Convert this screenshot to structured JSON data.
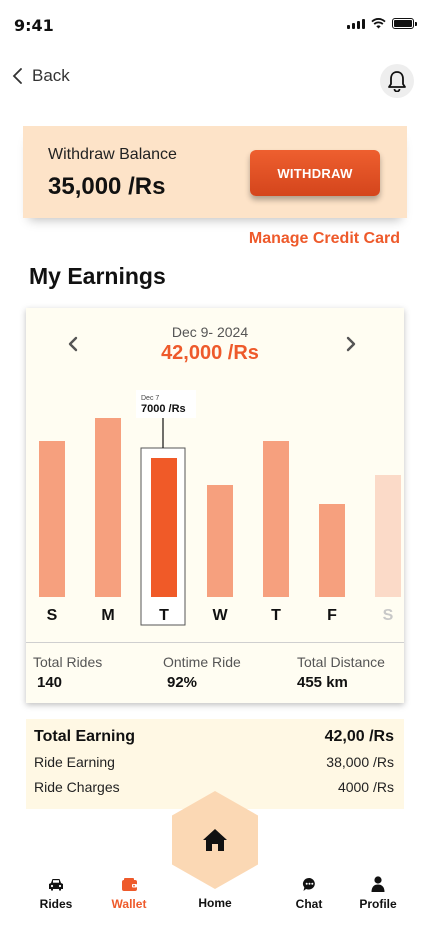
{
  "status_bar": {
    "time": "9:41"
  },
  "header": {
    "back_label": "Back"
  },
  "balance": {
    "label": "Withdraw Balance",
    "value": "35,000 /Rs",
    "withdraw_label": "WITHDRAW",
    "manage_label": "Manage Credit Card"
  },
  "earnings": {
    "title": "My Earnings",
    "date_range": "Dec 9- 2024",
    "total": "42,000 /Rs",
    "tooltip": {
      "date": "Dec 7",
      "value": "7000 /Rs"
    },
    "stats": [
      {
        "label": "Total Rides",
        "value": "140"
      },
      {
        "label": "Ontime Ride",
        "value": "92%"
      },
      {
        "label": "Total Distance",
        "value": "455 km"
      }
    ]
  },
  "chart_data": {
    "type": "bar",
    "categories": [
      "S",
      "M",
      "T",
      "W",
      "T",
      "F",
      "S"
    ],
    "values": [
      0.82,
      0.94,
      0.73,
      0.59,
      0.82,
      0.49,
      0.64
    ],
    "selected_index": 2,
    "faded_index": 6,
    "colors": {
      "bar": "#f6a07e",
      "selected": "#f05a28",
      "faded": "#fbdac8"
    }
  },
  "totals": {
    "total_label": "Total Earning",
    "total_value": "42,00 /Rs",
    "rows": [
      {
        "label": "Ride Earning",
        "value": "38,000 /Rs"
      },
      {
        "label": "Ride Charges",
        "value": "4000 /Rs"
      }
    ]
  },
  "nav": {
    "items": [
      {
        "label": "Rides",
        "icon": "car-icon"
      },
      {
        "label": "Wallet",
        "icon": "wallet-icon"
      },
      {
        "label": "Home",
        "icon": "home-icon"
      },
      {
        "label": "Chat",
        "icon": "chat-icon"
      },
      {
        "label": "Profile",
        "icon": "profile-icon"
      }
    ],
    "active": "Wallet"
  },
  "colors": {
    "accent": "#ee5a2b",
    "card_bg": "#fde3c8"
  }
}
